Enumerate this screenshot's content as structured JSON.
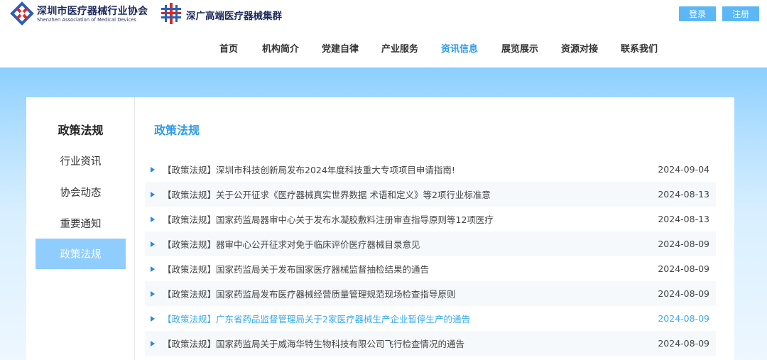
{
  "header": {
    "logo1_cn": "深圳市医疗器械行业协会",
    "logo1_en": "Shenzhen Association of Medical Devices",
    "logo2_cn": "深广高端医疗器械集群",
    "login_label": "登录",
    "register_label": "注册"
  },
  "nav": {
    "items": [
      "首页",
      "机构简介",
      "党建自律",
      "产业服务",
      "资讯信息",
      "展览展示",
      "资源对接",
      "联系我们"
    ],
    "active": "资讯信息"
  },
  "sidebar": {
    "title": "政策法规",
    "items": [
      "行业资讯",
      "协会动态",
      "重要通知",
      "政策法规"
    ],
    "active": "政策法规"
  },
  "main": {
    "title": "政策法规",
    "rows": [
      {
        "title": "【政策法规】深圳市科技创新局发布2024年度科技重大专项项目申请指南!",
        "date": "2024-09-04"
      },
      {
        "title": "【政策法规】关于公开征求《医疗器械真实世界数据 术语和定义》等2项行业标准意",
        "date": "2024-08-13"
      },
      {
        "title": "【政策法规】国家药监局器审中心关于发布水凝胶敷料注册审查指导原则等12项医疗",
        "date": "2024-08-13"
      },
      {
        "title": "【政策法规】器审中心公开征求对免于临床评价医疗器械目录意见",
        "date": "2024-08-09"
      },
      {
        "title": "【政策法规】国家药监局关于发布国家医疗器械监督抽检结果的通告",
        "date": "2024-08-09"
      },
      {
        "title": "【政策法规】国家药监局发布医疗器械经营质量管理规范现场检查指导原则",
        "date": "2024-08-09"
      },
      {
        "title": "【政策法规】广东省药品监督管理局关于2家医疗器械生产企业暂停生产的通告",
        "date": "2024-08-09"
      },
      {
        "title": "【政策法规】国家药监局关于威海华特生物科技有限公司飞行检查情况的通告",
        "date": "2024-08-09"
      }
    ],
    "highlighted_row": 6
  },
  "colors": {
    "accent": "#2e9be6",
    "button": "#5bb7f5",
    "sidebar_active": "#8fcdff",
    "highlight_text": "#3aaaf0"
  }
}
